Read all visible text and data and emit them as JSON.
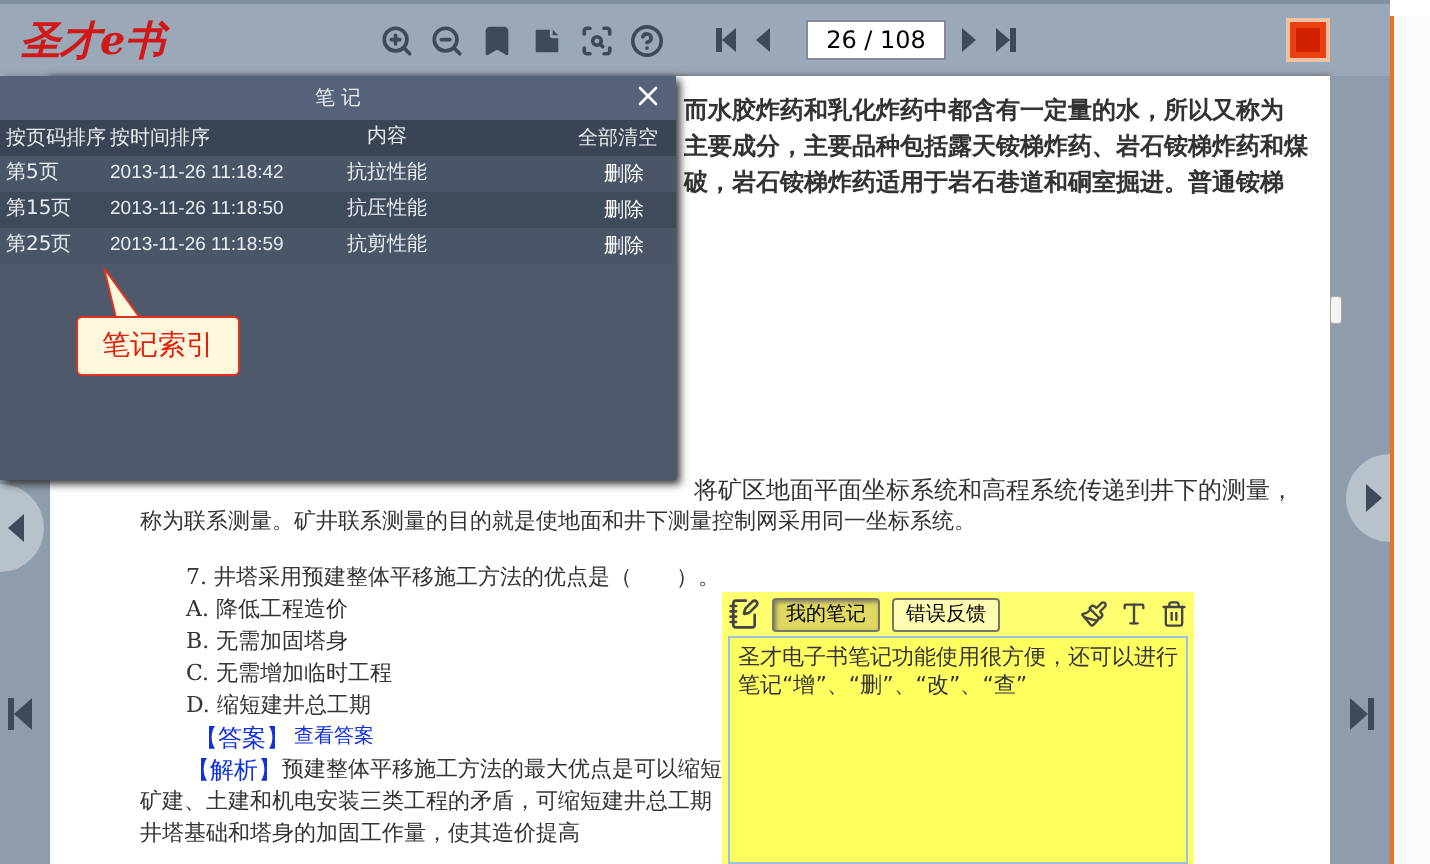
{
  "toolbar": {
    "logo": "圣才e书",
    "page_field": "26 / 108"
  },
  "notes_panel": {
    "title": "笔 记",
    "columns": [
      {
        "label": "按页码排序",
        "kind": "sort"
      },
      {
        "label": "按时间排序",
        "kind": "sort"
      },
      {
        "label": "内容",
        "kind": "text"
      },
      {
        "label": "全部清空",
        "kind": "action"
      }
    ],
    "rows": [
      {
        "page": "第5页",
        "time": "2013-11-26 11:18:42",
        "content": "抗拉性能",
        "action": "删除"
      },
      {
        "page": "第15页",
        "time": "2013-11-26 11:18:50",
        "content": "抗压性能",
        "action": "删除"
      },
      {
        "page": "第25页",
        "time": "2013-11-26 11:18:59",
        "content": "抗剪性能",
        "action": "删除"
      }
    ],
    "callout": "笔记索引"
  },
  "document": {
    "top_lines": [
      "而水胶炸药和乳化炸药中都含有一定量的水，所以又称为",
      "主要成分，主要品种包括露天铵梯炸药、岩石铵梯炸药和煤",
      "破，岩石铵梯炸药适用于岩石巷道和硐室掘进。普通铵梯"
    ],
    "partial_line": "将矿区地面平面坐标系统和高程系统传递到井下的测量，",
    "items": [
      {
        "kind": "continuation",
        "text": "称为联系测量。矿井联系测量的目的就是使地面和井下测量控制网采用同一坐标系统。"
      },
      {
        "kind": "question",
        "text": "7. 井塔采用预建整体平移施工方法的优点是（　　）。"
      },
      {
        "kind": "option",
        "text": "A. 降低工程造价"
      },
      {
        "kind": "option",
        "text": "B. 无需加固塔身"
      },
      {
        "kind": "option",
        "text": "C. 无需增加临时工程"
      },
      {
        "kind": "option",
        "text": "D. 缩短建井总工期"
      },
      {
        "kind": "answer",
        "label": "【答案】",
        "text": "查看答案"
      },
      {
        "kind": "analysis",
        "label": "【解析】",
        "text": "预建整体平移施工方法的最大优点是可以缩短"
      },
      {
        "kind": "continuation",
        "text": "矿建、土建和机电安装三类工程的矛盾，可缩短建井总工期"
      },
      {
        "kind": "continuation",
        "text": "井塔基础和塔身的加固工作量，使其造价提高"
      }
    ]
  },
  "sticky_note": {
    "buttons": [
      {
        "label": "我的笔记",
        "selected": true
      },
      {
        "label": "错误反馈",
        "selected": false
      }
    ],
    "text": "圣才电子书笔记功能使用很方便，还可以进行笔记“增”、“删”、“改”、“查”"
  }
}
